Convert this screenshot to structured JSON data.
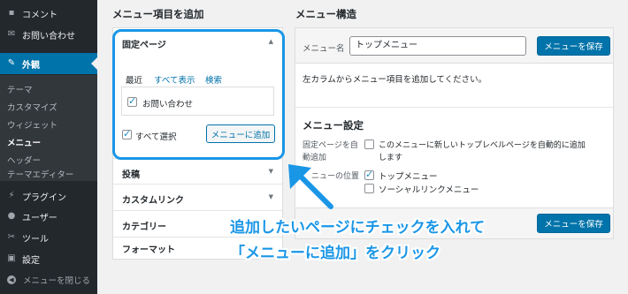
{
  "sidebar": {
    "items": [
      {
        "icon": "comment-icon",
        "glyph": "▪",
        "label": "コメント"
      },
      {
        "icon": "mail-icon",
        "glyph": "✉",
        "label": "お問い合わせ"
      },
      {
        "icon": "paintbrush-icon",
        "glyph": "✎",
        "label": "外観"
      },
      {
        "icon": "plugin-icon",
        "glyph": "⚡",
        "label": "プラグイン"
      },
      {
        "icon": "user-icon",
        "glyph": "●",
        "label": "ユーザー"
      },
      {
        "icon": "wrench-icon",
        "glyph": "✂",
        "label": "ツール"
      },
      {
        "icon": "settings-icon",
        "glyph": "▣",
        "label": "設定"
      }
    ],
    "submenu": [
      "テーマ",
      "カスタマイズ",
      "ウィジェット",
      "メニュー",
      "ヘッダー",
      "テーマエディター"
    ],
    "collapse_label": "メニューを閉じる",
    "accent": "#0073aa"
  },
  "add_items": {
    "heading": "メニュー項目を追加",
    "sections": {
      "pages": "固定ページ",
      "posts": "投稿",
      "custom_links": "カスタムリンク",
      "categories": "カテゴリー",
      "formats": "フォーマット"
    },
    "tabs": [
      "最近",
      "すべて表示",
      "検索"
    ],
    "page_item": "お問い合わせ",
    "select_all": "すべて選択",
    "add_button": "メニューに追加"
  },
  "structure": {
    "heading": "メニュー構造",
    "name_label": "メニュー名",
    "name_value": "トップメニュー",
    "save_button": "メニューを保存",
    "hint": "左カラムからメニュー項目を追加してください。",
    "settings_heading": "メニュー設定",
    "auto_add_label_1": "固定ページを自",
    "auto_add_label_2": "動追加",
    "auto_add_option_1": "このメニューに新しいトップレベルページを自動的に追加",
    "auto_add_option_2": "します",
    "location_label": "ニューの位置",
    "location_top": "トップメニュー",
    "location_social": "ソーシャルリンクメニュー"
  },
  "annotation": {
    "line1": "追加したいページにチェックを入れて",
    "line2": "「メニューに追加」をクリック",
    "color": "#1a96e6"
  }
}
